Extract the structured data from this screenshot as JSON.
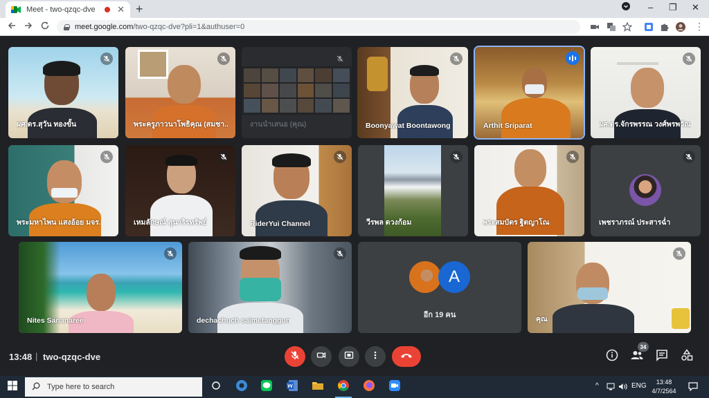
{
  "browser": {
    "tab_title": "Meet - two-qzqc-dve",
    "url_host": "meet.google.com",
    "url_path": "/two-qzqc-dve?pli=1&authuser=0",
    "new_tab_symbol": "+",
    "tab_close_symbol": "✕",
    "window_controls": {
      "minimize": "⌄",
      "restore": "–",
      "maximize": "❐",
      "close": "✕"
    }
  },
  "participants": {
    "p1": {
      "name": "ผศ.ดร.สุวัน ทองขั้น",
      "muted": true
    },
    "p2": {
      "name": "พระครูภาวนาโพธิคุณ (สมชา...",
      "muted": true
    },
    "p3": {
      "name": "งานนำเสนอ (คุณ)",
      "muted": true
    },
    "p4": {
      "name": "Boonyawat Boontawong",
      "muted": true
    },
    "p5": {
      "name": "Arthit Sriparat",
      "muted": false,
      "speaking": true
    },
    "p6": {
      "name": "ผศ.ดร.จักรพรรณ วงศ์พรพวัณ",
      "muted": true
    },
    "p7": {
      "name": "พระมหาไพน แสงอ้อย มจร.",
      "muted": true
    },
    "p8": {
      "name": "เหมลักษณ์ สุนาริรทรัพย์",
      "muted": true
    },
    "p9": {
      "name": "RiderYui Channel",
      "muted": true
    },
    "p10": {
      "name": "วีรพล ดวงก้อม",
      "muted": true
    },
    "p11": {
      "name": "พระสมบัตร ฐิตญาโณ",
      "muted": true
    },
    "p12": {
      "name": "เพชราภรณ์ ประสารฉ่ำ",
      "muted": true
    },
    "p13": {
      "name": "Nites Sananaree",
      "muted": true
    },
    "p14": {
      "name": "dechachuch saimetanggun",
      "muted": true
    },
    "p15": {
      "name": "คุณ",
      "muted": true
    }
  },
  "others": {
    "label": "อีก 19 คน",
    "avatar_letter": "A"
  },
  "meeting": {
    "time": "13:48",
    "separator": "|",
    "code": "two-qzqc-dve",
    "participant_count": "34"
  },
  "taskbar": {
    "search_placeholder": "Type here to search",
    "language": "ENG",
    "time": "13:48",
    "date": "4/7/2564",
    "tray_arrow": "^"
  },
  "colors": {
    "meet_bg": "#202124",
    "tile_bg": "#3c4043",
    "speaking_accent": "#1a73e8",
    "end_call": "#ea4335",
    "taskbar_bg": "#1f2a36"
  }
}
